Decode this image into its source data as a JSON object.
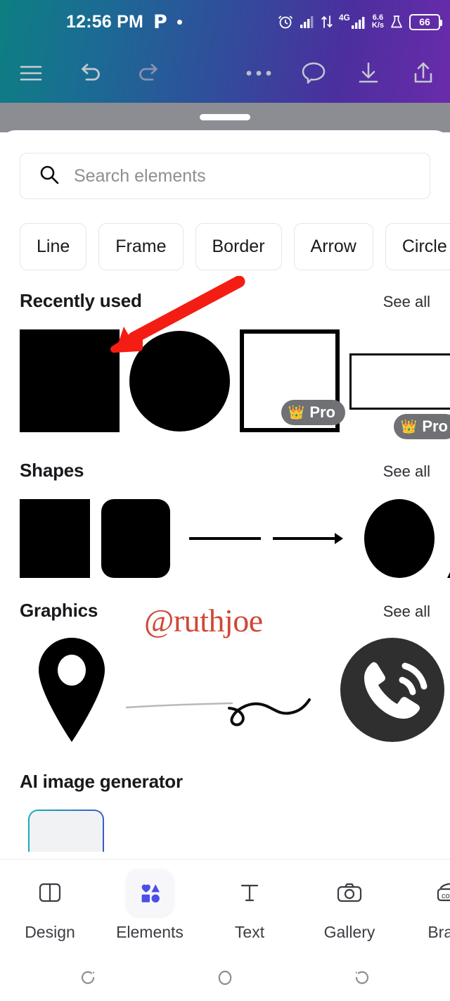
{
  "status_bar": {
    "time": "12:56 PM",
    "notification_icon": "pinterest-p-icon",
    "notification_dot": "notification-dot",
    "alarm_icon": "alarm-clock-icon",
    "signal_icon": "signal-bars-icon",
    "data_transfer_icon": "data-transfer-icon",
    "network_type": "4G",
    "network_signal_icon": "signal-bars-4g-icon",
    "data_speed_value": "6.6",
    "data_speed_unit": "K/s",
    "flask_icon": "flask-icon",
    "battery_level": "66"
  },
  "editor_toolbar": {
    "menu_label": "menu-icon",
    "undo_label": "undo-icon",
    "redo_label": "redo-icon",
    "more_label": "more-options-icon",
    "comment_label": "comment-icon",
    "download_label": "download-icon",
    "share_label": "share-icon"
  },
  "search": {
    "placeholder": "Search elements",
    "icon": "search-icon"
  },
  "chips": [
    {
      "label": "Line"
    },
    {
      "label": "Frame"
    },
    {
      "label": "Border"
    },
    {
      "label": "Arrow"
    },
    {
      "label": "Circle"
    }
  ],
  "sections": {
    "recently_used": {
      "title": "Recently used",
      "see_all": "See all",
      "items": [
        {
          "name": "square-solid",
          "pro": false
        },
        {
          "name": "circle-solid",
          "pro": false
        },
        {
          "name": "frame-square-outline",
          "pro": true,
          "pro_label": "Pro"
        },
        {
          "name": "rectangle-outline",
          "pro": true,
          "pro_label": "Pro"
        }
      ]
    },
    "shapes": {
      "title": "Shapes",
      "see_all": "See all",
      "items": [
        {
          "name": "square"
        },
        {
          "name": "rounded-square"
        },
        {
          "name": "line"
        },
        {
          "name": "arrow"
        },
        {
          "name": "circle"
        },
        {
          "name": "triangle"
        }
      ]
    },
    "graphics": {
      "title": "Graphics",
      "see_all": "See all",
      "items": [
        {
          "name": "location-pin-graphic"
        },
        {
          "name": "squiggle-line-graphic"
        },
        {
          "name": "phone-call-graphic"
        }
      ]
    },
    "ai_image_generator": {
      "title": "AI image generator"
    }
  },
  "watermark": {
    "text": "@ruthjoe",
    "color": "#d04836"
  },
  "annotation": {
    "arrow_color": "#f41d14",
    "description": "red-arrow-pointing-to-first-recently-used-shape"
  },
  "bottom_nav": {
    "active_item": "Elements",
    "items": [
      {
        "label": "Design",
        "icon": "design-layout-icon",
        "active": false
      },
      {
        "label": "Elements",
        "icon": "elements-shapes-icon",
        "active": true
      },
      {
        "label": "Text",
        "icon": "text-t-icon",
        "active": false
      },
      {
        "label": "Gallery",
        "icon": "camera-icon",
        "active": false
      },
      {
        "label": "Brand",
        "icon": "brand-icon",
        "active": false
      }
    ],
    "active_color": "#4b4ee8"
  },
  "android_nav": {
    "recent_label": "recent-apps-icon",
    "home_label": "home-icon",
    "back_label": "back-icon"
  }
}
